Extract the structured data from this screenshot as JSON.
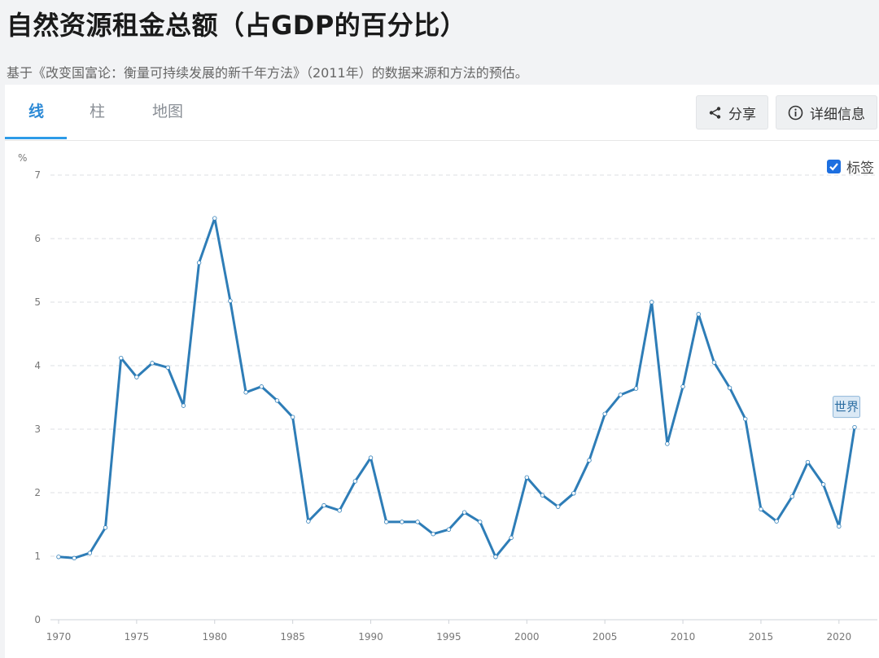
{
  "header": {
    "title": "自然资源租金总额（占GDP的百分比）",
    "subtitle": "基于《改变国富论：衡量可持续发展的新千年方法》（2011年）的数据来源和方法的预估。"
  },
  "tabs": [
    {
      "label": "线",
      "active": true
    },
    {
      "label": "柱",
      "active": false
    },
    {
      "label": "地图",
      "active": false
    }
  ],
  "buttons": {
    "share_label": "分享",
    "details_label": "详细信息"
  },
  "labels_toggle": {
    "label": "标签",
    "checked": true
  },
  "icons": {
    "share": "share-icon",
    "info": "info-icon",
    "check": "check-icon"
  },
  "colors": {
    "line": "#2e7db7",
    "accent": "#2d9be8",
    "checkbox": "#1d6fe0"
  },
  "chart_data": {
    "type": "line",
    "title": "",
    "xlabel": "",
    "ylabel": "%",
    "ylim": [
      0,
      7
    ],
    "yticks": [
      0,
      1,
      2,
      3,
      4,
      5,
      6,
      7
    ],
    "xlim": [
      1970,
      2021
    ],
    "xticks": [
      1970,
      1975,
      1980,
      1985,
      1990,
      1995,
      2000,
      2005,
      2010,
      2015,
      2020
    ],
    "grid": true,
    "series": [
      {
        "name": "世界",
        "x": [
          1970,
          1971,
          1972,
          1973,
          1974,
          1975,
          1976,
          1977,
          1978,
          1979,
          1980,
          1981,
          1982,
          1983,
          1984,
          1985,
          1986,
          1987,
          1988,
          1989,
          1990,
          1991,
          1992,
          1993,
          1994,
          1995,
          1996,
          1997,
          1998,
          1999,
          2000,
          2001,
          2002,
          2003,
          2004,
          2005,
          2006,
          2007,
          2008,
          2009,
          2010,
          2011,
          2012,
          2013,
          2014,
          2015,
          2016,
          2017,
          2018,
          2019,
          2020,
          2021
        ],
        "values": [
          0.99,
          0.97,
          1.05,
          1.45,
          4.12,
          3.82,
          4.04,
          3.97,
          3.37,
          5.62,
          6.32,
          5.02,
          3.58,
          3.67,
          3.45,
          3.19,
          1.55,
          1.8,
          1.72,
          2.18,
          2.55,
          1.54,
          1.54,
          1.54,
          1.35,
          1.42,
          1.69,
          1.54,
          0.99,
          1.29,
          2.24,
          1.96,
          1.78,
          1.99,
          2.51,
          3.24,
          3.54,
          3.64,
          5.0,
          2.77,
          3.67,
          4.81,
          4.05,
          3.65,
          3.16,
          1.74,
          1.55,
          1.94,
          2.48,
          2.13,
          1.47,
          3.03
        ]
      }
    ]
  }
}
